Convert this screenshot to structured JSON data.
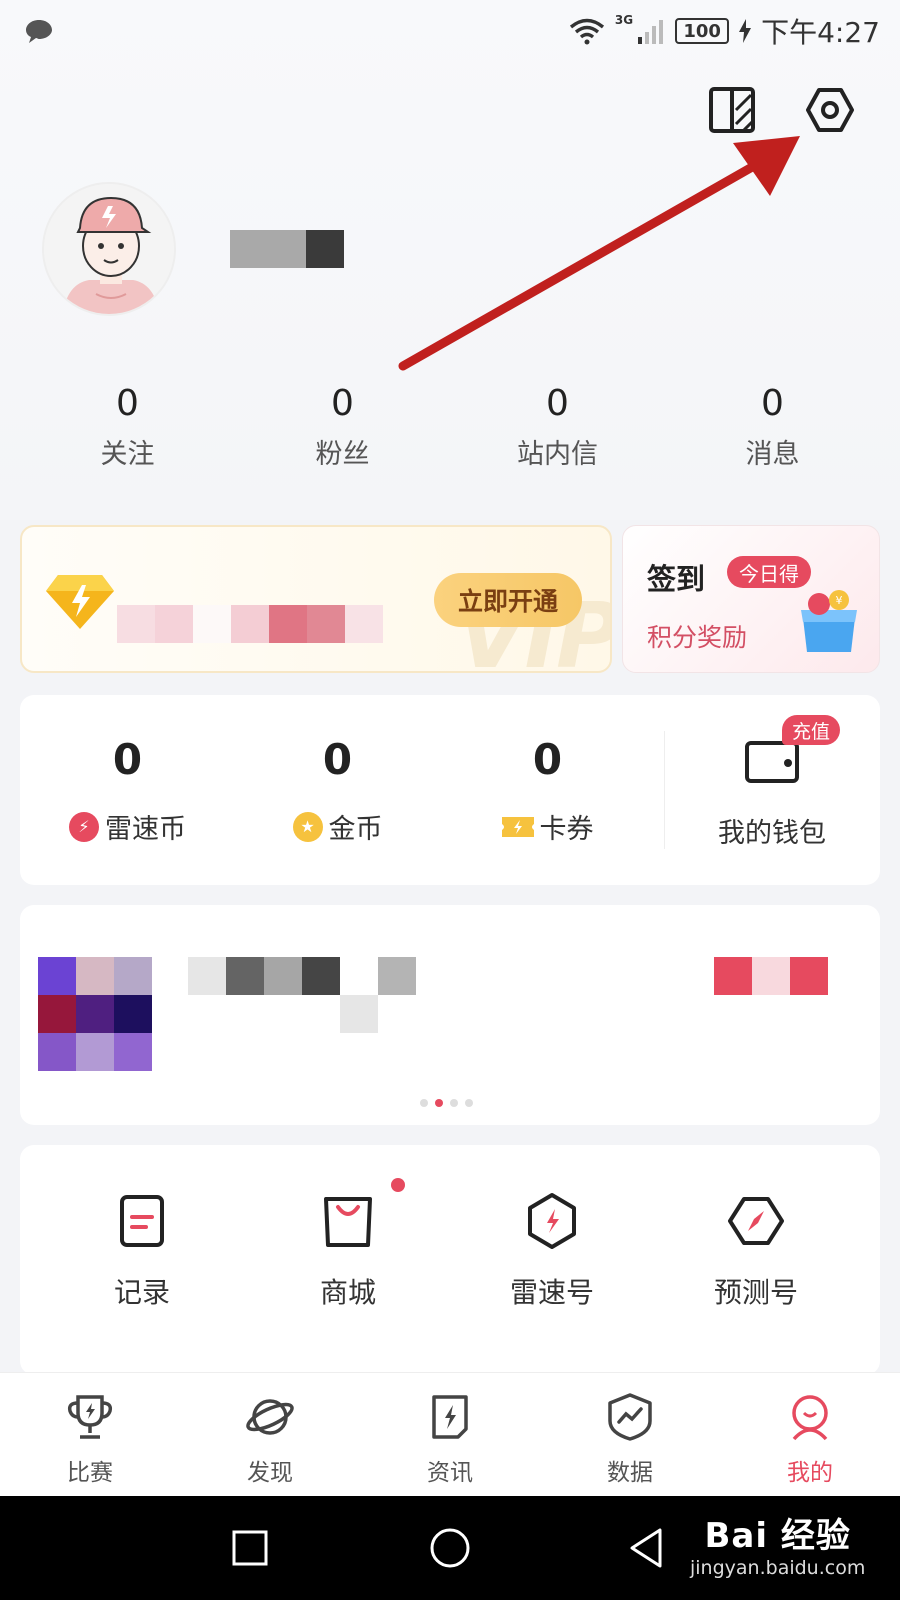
{
  "status_bar": {
    "time": "下午4:27",
    "battery": "100",
    "network": "3G"
  },
  "top_icons": [
    "theme-switch-icon",
    "settings-icon"
  ],
  "profile": {
    "stats": [
      {
        "value": "0",
        "label": "关注"
      },
      {
        "value": "0",
        "label": "粉丝"
      },
      {
        "value": "0",
        "label": "站内信"
      },
      {
        "value": "0",
        "label": "消息"
      }
    ]
  },
  "vip": {
    "button_label": "立即开通",
    "watermark": "VIP"
  },
  "sign_in": {
    "title": "签到",
    "badge": "今日得",
    "reward": "积分奖励"
  },
  "wallet": {
    "items": [
      {
        "value": "0",
        "label": "雷速币",
        "icon": "leisu-coin-icon"
      },
      {
        "value": "0",
        "label": "金币",
        "icon": "gold-coin-icon"
      },
      {
        "value": "0",
        "label": "卡券",
        "icon": "coupon-icon"
      }
    ],
    "recharge_badge": "充值",
    "wallet_label": "我的钱包"
  },
  "tools": [
    {
      "label": "记录",
      "icon": "record-icon"
    },
    {
      "label": "商城",
      "icon": "mall-icon"
    },
    {
      "label": "雷速号",
      "icon": "leisu-account-icon"
    },
    {
      "label": "预测号",
      "icon": "prediction-icon"
    }
  ],
  "bottom_nav": [
    {
      "label": "比赛",
      "icon": "trophy-icon"
    },
    {
      "label": "发现",
      "icon": "planet-icon"
    },
    {
      "label": "资讯",
      "icon": "news-icon"
    },
    {
      "label": "数据",
      "icon": "data-icon"
    },
    {
      "label": "我的",
      "icon": "profile-icon",
      "active": true
    }
  ],
  "watermark": {
    "main": "Bai 经验",
    "sub": "jingyan.baidu.com"
  },
  "colors": {
    "accent": "#e64a5f",
    "vip_button": "#f6c766",
    "annotation_arrow": "#c0201e"
  }
}
